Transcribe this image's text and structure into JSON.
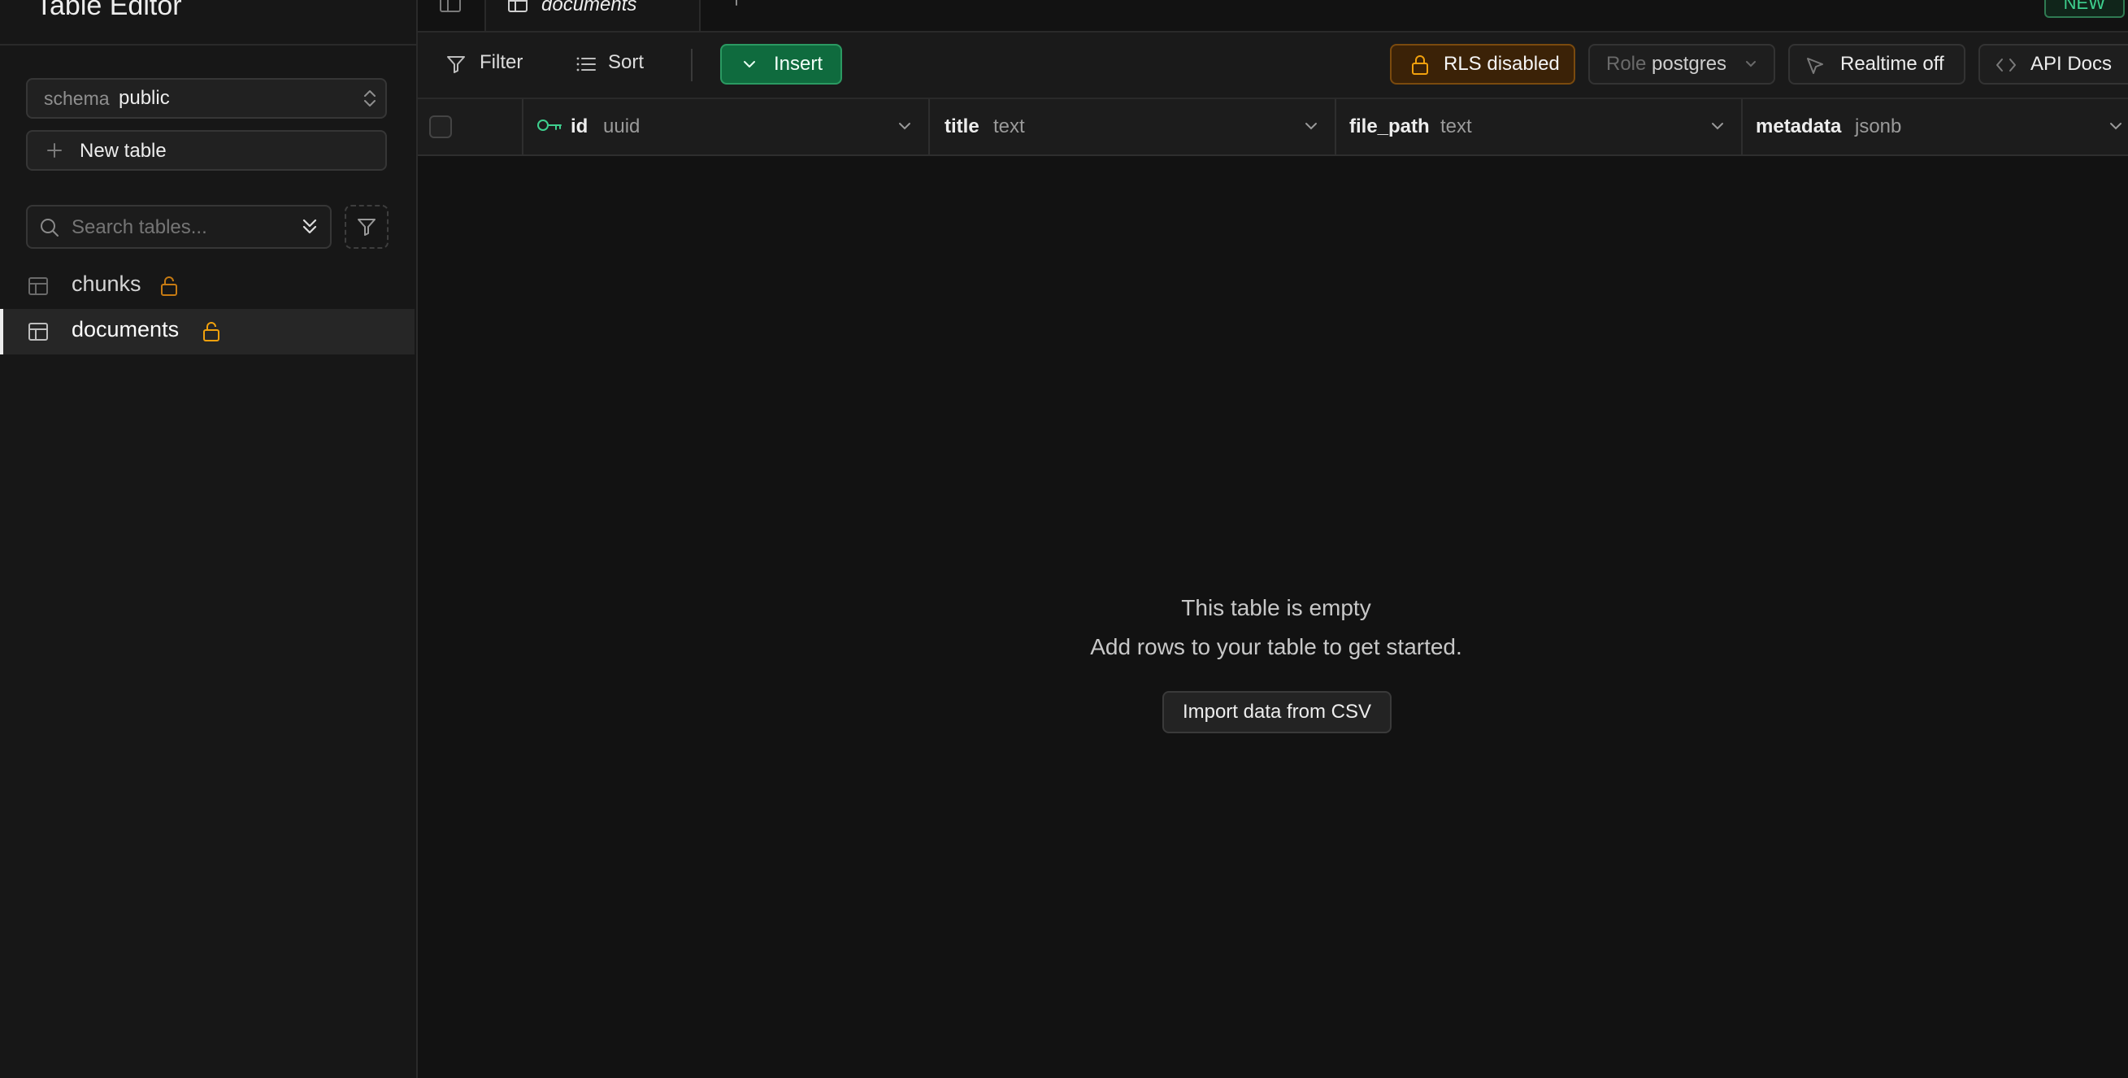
{
  "sidebar": {
    "title": "Table Editor",
    "schema": {
      "label": "schema",
      "value": "public"
    },
    "new_table_label": "New table",
    "search": {
      "placeholder": "Search tables..."
    },
    "tables": [
      {
        "name": "chunks",
        "active": false,
        "rls_icon": "unlock-icon"
      },
      {
        "name": "documents",
        "active": true,
        "rls_icon": "unlock-icon"
      }
    ]
  },
  "tabs": {
    "active_tab": "documents",
    "add_tab_icon": "plus-icon",
    "badge": "NEW"
  },
  "toolbar": {
    "filter_label": "Filter",
    "sort_label": "Sort",
    "insert_label": "Insert",
    "rls_label": "RLS disabled",
    "role_label": "Role",
    "role_value": "postgres",
    "realtime_label": "Realtime off",
    "api_docs_label": "API Docs"
  },
  "columns": [
    {
      "name": "id",
      "type": "uuid",
      "primary_key": true
    },
    {
      "name": "title",
      "type": "text"
    },
    {
      "name": "file_path",
      "type": "text"
    },
    {
      "name": "metadata",
      "type": "jsonb"
    }
  ],
  "empty_state": {
    "title": "This table is empty",
    "subtitle": "Add rows to your table to get started.",
    "import_label": "Import data from CSV"
  },
  "colors": {
    "brand_green": "#3ecf8e",
    "warning_orange": "#f1a10d",
    "background": "#121212"
  }
}
